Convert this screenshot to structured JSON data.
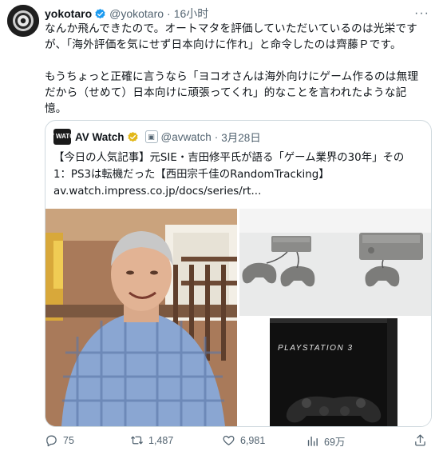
{
  "tweet": {
    "display_name": "yokotaro",
    "handle": "@yokotaro",
    "separator": "·",
    "time": "16小时",
    "more_label": "···",
    "text": "なんか飛んできたので。オートマタを評価していただいているのは光栄ですが、「海外評価を気にせず日本向けに作れ」と命令したのは齊藤Ｐです。\n\nもうちょっと正確に言うなら「ヨコオさんは海外向けにゲーム作るのは無理だから（せめて）日本向けに頑張ってくれ」的なことを言われたような記憶。"
  },
  "quote": {
    "logo_text": "AV WATCH",
    "display_name": "AV Watch",
    "badge": "▣",
    "handle": "@avwatch",
    "separator": "·",
    "date": "3月28日",
    "lines": [
      "【今日の人気記事】元SIE・吉田修平氏が語る「ゲーム業界の30年」その",
      "1：PS3は転機だった【西田宗千佳のRandomTracking】",
      "av.watch.impress.co.jp/docs/series/rt..."
    ],
    "ps3_logo_text": "PLAYSTATION 3"
  },
  "actions": {
    "reply_count": "75",
    "retweet_count": "1,487",
    "like_count": "6,981",
    "view_count": "69万"
  },
  "colors": {
    "verified_gold": "#e2b719",
    "muted": "#536471",
    "border": "#cfd9de"
  }
}
